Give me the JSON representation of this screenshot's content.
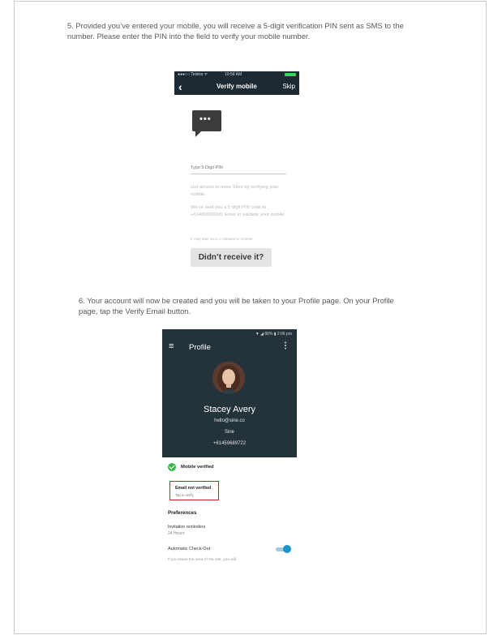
{
  "step5": {
    "text": "5. Provided you’ve entered your mobile, you will receive a 5-digit verification PIN sent as SMS to the number. Please enter the PIN into the field to verify your mobile number."
  },
  "verify_screen": {
    "status_carrier": "●●●○○ Telstra ᯤ",
    "status_time": "10:58 AM",
    "nav_back": "‹",
    "nav_title": "Verify mobile",
    "nav_skip": "Skip",
    "chat_icon_dots": "•••",
    "pin_placeholder": "Type 5 Digit PIN",
    "info_1": "Get access to more Sites by verifying your mobile.",
    "info_2": "We’ve sent you a 5 digit PIN code to +61400000000. Enter to validate your mobile.",
    "info_3": "It may take up to 2 minutes to receive.",
    "resend_label": "Didn’t receive it?",
    "colors": {
      "nav_bg": "#1e2a33",
      "battery": "#38d65a",
      "button_bg": "#e4e4e4"
    }
  },
  "step6": {
    "text": "6. Your account will now be created and you will be taken to your Profile page. On your Profile page, tap the Verify Email button."
  },
  "profile_screen": {
    "status": "▼ ◢ 88% ▮ 2:06 pm",
    "menu_icon": "≡",
    "title": "Profile",
    "kebab_icon": "⋮",
    "name": "Stacey Avery",
    "email": "hello@sine.co",
    "company": "Sine",
    "phone": "+61459689722",
    "mobile_verified": "Mobile verified",
    "email_status": "Email not verified",
    "email_hint": "Tap to verify",
    "preferences_heading": "Preferences",
    "invitation_label": "Invitation reminders",
    "invitation_value": "24 Hours",
    "auto_checkout_label": "Automatic Check-Out",
    "auto_checkout_desc": "If you leave the area of the site, you will",
    "auto_checkout_on": true,
    "colors": {
      "header_bg": "#24323a",
      "check": "#3cb54a",
      "highlight": "#c8242b",
      "toggle": "#1f93c9"
    }
  }
}
